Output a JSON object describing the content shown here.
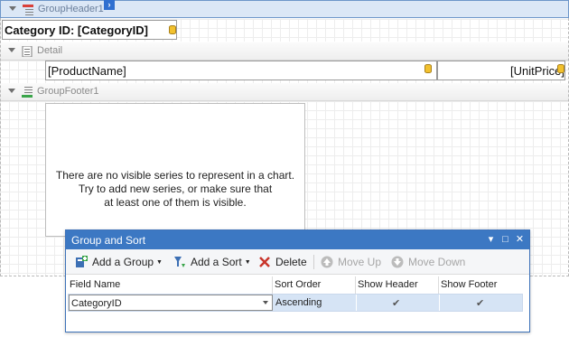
{
  "design": {
    "group_header": {
      "title": "GroupHeader1",
      "field_text": "Category ID: [CategoryID]"
    },
    "detail": {
      "title": "Detail",
      "product_name": "[ProductName]",
      "unit_price": "[UnitPrice]"
    },
    "group_footer": {
      "title": "GroupFooter1",
      "chart_message": [
        "There are no visible series to represent in a chart.",
        "Try to add new series, or make sure that",
        "at least one of them is visible."
      ]
    }
  },
  "panel": {
    "title": "Group and Sort",
    "controls": {
      "dropdown": "▾",
      "maximize": "□",
      "close": "✕"
    },
    "toolbar": {
      "add_group": "Add a Group",
      "add_sort": "Add a Sort",
      "delete": "Delete",
      "move_up": "Move Up",
      "move_down": "Move Down"
    },
    "columns": [
      "Field Name",
      "Sort Order",
      "Show Header",
      "Show Footer"
    ],
    "rows": [
      {
        "field_name": "CategoryID",
        "sort_order": "Ascending",
        "show_header": "✔",
        "show_footer": "✔"
      }
    ]
  },
  "colors": {
    "accent": "#3c78c3",
    "selection": "#d6e4f5",
    "band_selected": "#dbe7f6"
  },
  "icons": [
    "group-header-icon",
    "detail-icon",
    "group-footer-icon",
    "database-field-icon",
    "add-group-icon",
    "add-sort-icon",
    "delete-icon",
    "move-up-icon",
    "move-down-icon",
    "checkmark-icon",
    "smart-tag-icon"
  ]
}
